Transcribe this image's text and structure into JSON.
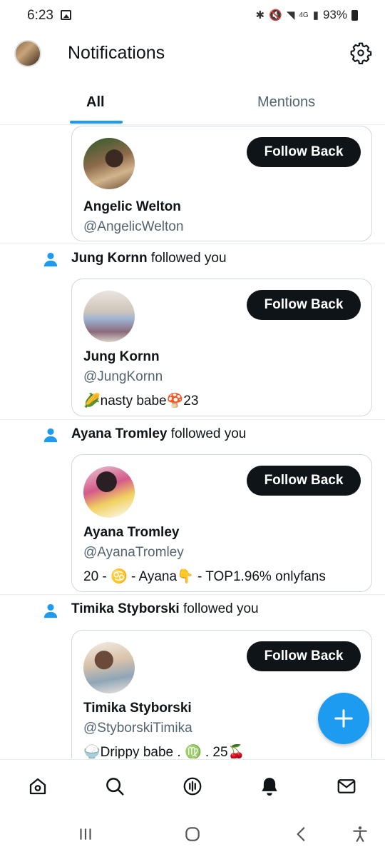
{
  "status_bar": {
    "time": "6:23",
    "network": "4G",
    "battery": "93%"
  },
  "header": {
    "title": "Notifications",
    "settings_icon": "gear-icon"
  },
  "tabs": [
    {
      "label": "All",
      "active": true
    },
    {
      "label": "Mentions",
      "active": false
    }
  ],
  "notifications": [
    {
      "actor": "",
      "action": "",
      "name": "Angelic Welton",
      "handle": "@AngelicWelton",
      "bio": "",
      "button": "Follow Back"
    },
    {
      "actor": "Jung Kornn",
      "action": "followed you",
      "name": "Jung Kornn",
      "handle": "@JungKornn",
      "bio": "🌽nasty babe🍄23",
      "button": "Follow Back"
    },
    {
      "actor": "Ayana Tromley",
      "action": "followed you",
      "name": "Ayana Tromley",
      "handle": "@AyanaTromley",
      "bio": "20 - ♋ - Ayana👇 - TOP1.96% onlyfans",
      "button": "Follow Back"
    },
    {
      "actor": "Timika Styborski",
      "action": "followed you",
      "name": "Timika Styborski",
      "handle": "@StyborskiTimika",
      "bio": "🍚Drippy babe . ♍ . 25🍒",
      "button": "Follow Back"
    }
  ],
  "fab": {
    "icon": "plus-icon"
  },
  "bottom_nav": [
    "home-icon",
    "search-icon",
    "spaces-icon",
    "notifications-icon",
    "messages-icon"
  ],
  "system_nav": [
    "recents-icon",
    "home-circle-icon",
    "back-icon",
    "accessibility-icon"
  ],
  "colors": {
    "accent": "#1d9bf0",
    "button_bg": "#0f1419",
    "secondary_text": "#536471"
  }
}
